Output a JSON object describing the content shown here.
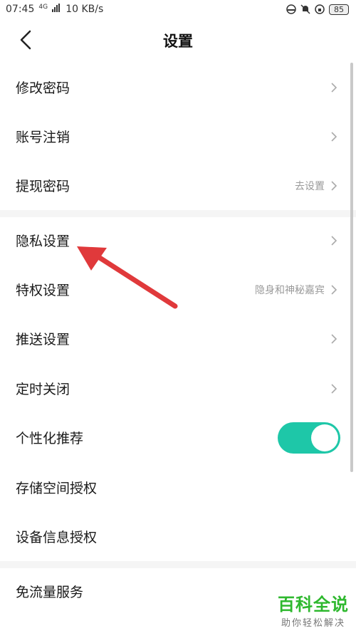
{
  "status_bar": {
    "time": "07:45",
    "network_tag": "4G",
    "speed": "10 KB/s",
    "battery": "85"
  },
  "header": {
    "title": "设置"
  },
  "rows": [
    {
      "label": "修改密码",
      "value": ""
    },
    {
      "label": "账号注销",
      "value": ""
    },
    {
      "label": "提现密码",
      "value": "去设置"
    },
    {
      "label": "隐私设置",
      "value": ""
    },
    {
      "label": "特权设置",
      "value": "隐身和神秘嘉宾"
    },
    {
      "label": "推送设置",
      "value": ""
    },
    {
      "label": "定时关闭",
      "value": ""
    },
    {
      "label": "个性化推荐",
      "value": ""
    },
    {
      "label": "存储空间授权",
      "value": ""
    },
    {
      "label": "设备信息授权",
      "value": ""
    },
    {
      "label": "免流量服务",
      "value": ""
    }
  ],
  "toggle_personalized": {
    "on": true
  },
  "colors": {
    "toggle_on": "#1ec7a8",
    "annotation_arrow": "#e0393b",
    "watermark": "#2eb82e"
  },
  "watermark": {
    "title": "百科全说",
    "subtitle": "助你轻松解决"
  }
}
